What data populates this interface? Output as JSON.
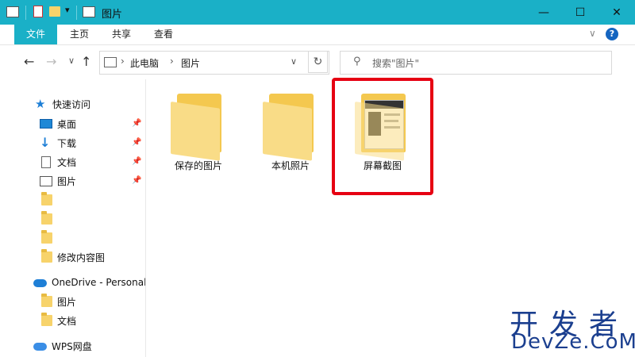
{
  "window": {
    "title": "图片",
    "minimize": "—",
    "maximize": "☐",
    "close": "✕"
  },
  "ribbon": {
    "tabs": [
      "文件",
      "主页",
      "共享",
      "查看"
    ],
    "expand_icon": "chevron-down-icon",
    "help": "?"
  },
  "navigation": {
    "back": "←",
    "forward": "→",
    "recent": "∨",
    "up": "↑"
  },
  "address_bar": {
    "path": [
      "此电脑",
      "图片"
    ],
    "dropdown": "∨",
    "refresh": "↻"
  },
  "search": {
    "placeholder": "搜索\"图片\""
  },
  "sidebar": {
    "quick_access": "快速访问",
    "items": [
      {
        "label": "桌面",
        "icon": "desktop-icon",
        "pinned": true
      },
      {
        "label": "下载",
        "icon": "download-arrow-icon",
        "pinned": true
      },
      {
        "label": "文档",
        "icon": "document-icon",
        "pinned": true
      },
      {
        "label": "图片",
        "icon": "pictures-icon",
        "pinned": true
      },
      {
        "label": "",
        "icon": "folder-icon",
        "pinned": false
      },
      {
        "label": "",
        "icon": "folder-icon",
        "pinned": false
      },
      {
        "label": "",
        "icon": "folder-icon",
        "pinned": false
      },
      {
        "label": "修改内容图",
        "icon": "folder-icon",
        "pinned": false
      }
    ],
    "onedrive": "OneDrive - Personal",
    "onedrive_items": [
      {
        "label": "图片",
        "icon": "folder-icon"
      },
      {
        "label": "文档",
        "icon": "folder-icon"
      }
    ],
    "wps": "WPS网盘"
  },
  "content": {
    "folders": [
      {
        "label": "保存的图片"
      },
      {
        "label": "本机照片"
      },
      {
        "label": "屏幕截图"
      }
    ]
  },
  "watermark": {
    "cn": "开发者",
    "en": "DevZe.CoM"
  },
  "colors": {
    "accent": "#1ab0c7",
    "folder": "#f7d36b",
    "highlight": "#e60012",
    "watermark": "#1b3f8f"
  }
}
